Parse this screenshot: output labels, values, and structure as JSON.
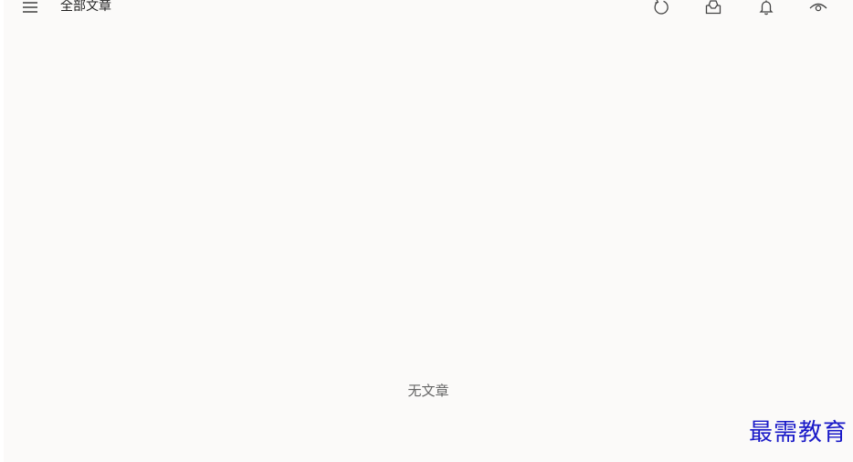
{
  "header": {
    "title": "全部文章",
    "menu_icon": "hamburger-menu-icon",
    "tools": [
      {
        "name": "refresh",
        "icon": "refresh-icon"
      },
      {
        "name": "inbox",
        "icon": "inbox-icon"
      },
      {
        "name": "notifications",
        "icon": "bell-icon"
      },
      {
        "name": "view",
        "icon": "eye-icon"
      }
    ]
  },
  "main": {
    "empty_message": "无文章"
  },
  "watermark": {
    "text": "最需教育"
  },
  "colors": {
    "background": "#fbfaf9",
    "title_text": "#1f1f1f",
    "muted_text": "#666666",
    "watermark": "#1a1ac8"
  }
}
